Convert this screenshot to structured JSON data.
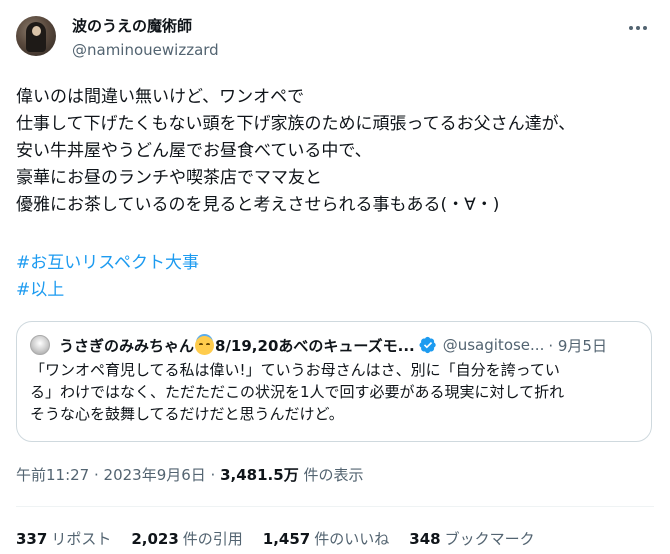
{
  "author": {
    "display_name": "波のうえの魔術師",
    "handle": "@naminouewizzard"
  },
  "tweet": {
    "text": "偉いのは間違い無いけど、ワンオペで\n仕事して下げたくもない頭を下げ家族のために頑張ってるお父さん達が、\n安い牛丼屋やうどん屋でお昼食べている中で、\n豪華にお昼のランチや喫茶店でママ友と\n優雅にお茶しているのを見ると考えさせられる事もある(・∀・)",
    "hashtags": [
      "#お互いリスペクト大事",
      "#以上"
    ]
  },
  "quote": {
    "name_part1": "うさぎのみみちゃん",
    "emoji": "smiling-face-with-halo",
    "name_part2": "8/19,20あべのキューズモ...",
    "handle": "@usagitose...",
    "date": "· 9月5日",
    "text": "「ワンオペ育児してる私は偉い!」ていうお母さんはさ、別に「自分を誇ってい\nる」わけではなく、ただただこの状況を1人で回す必要がある現実に対して折れ\nそうな心を鼓舞してるだけだと思うんだけど。"
  },
  "meta": {
    "time": "午前11:27 · 2023年9月6日 · ",
    "views_count": "3,481.5万",
    "views_label": " 件の表示"
  },
  "stats": {
    "reposts_count": "337",
    "reposts_label": "リポスト",
    "quotes_count": "2,023",
    "quotes_label": "件の引用",
    "likes_count": "1,457",
    "likes_label": "件のいいね",
    "bookmarks_count": "348",
    "bookmarks_label": "ブックマーク"
  },
  "colors": {
    "hashtag": "#1d9bf0",
    "secondary_text": "#536471",
    "verified": "#1d9bf0"
  }
}
